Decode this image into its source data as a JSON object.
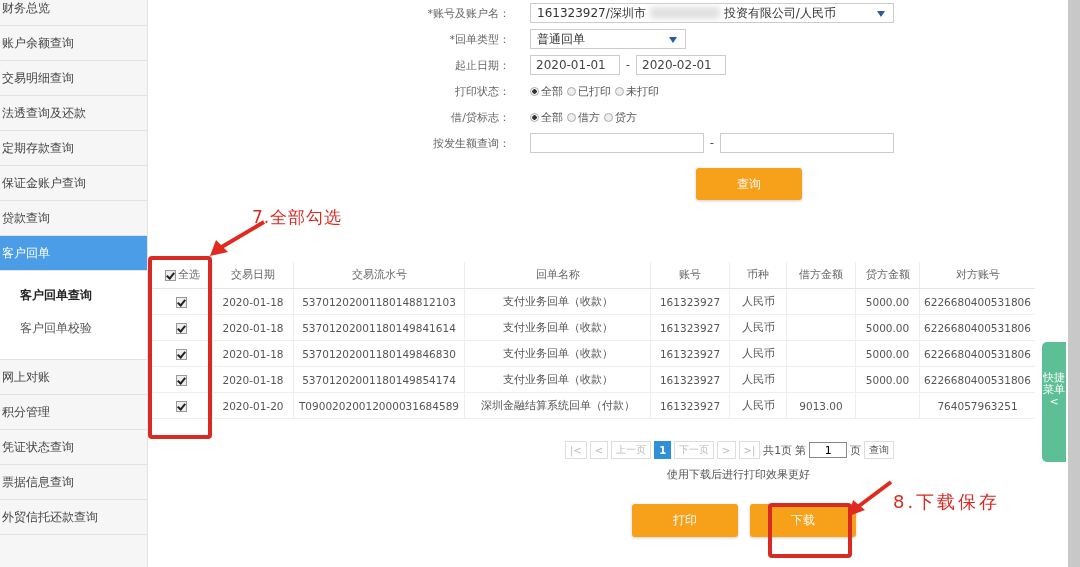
{
  "sidebar": {
    "items": [
      {
        "label": "财务总览",
        "selected": false
      },
      {
        "label": "账户余额查询",
        "selected": false
      },
      {
        "label": "交易明细查询",
        "selected": false
      },
      {
        "label": "法透查询及还款",
        "selected": false
      },
      {
        "label": "定期存款查询",
        "selected": false
      },
      {
        "label": "保证金账户查询",
        "selected": false
      },
      {
        "label": "贷款查询",
        "selected": false
      },
      {
        "label": "客户回单",
        "selected": true,
        "children": [
          {
            "label": "客户回单查询",
            "selected": true
          },
          {
            "label": "客户回单校验",
            "selected": false
          }
        ]
      },
      {
        "label": "网上对账",
        "selected": false
      },
      {
        "label": "积分管理",
        "selected": false
      },
      {
        "label": "凭证状态查询",
        "selected": false
      },
      {
        "label": "票据信息查询",
        "selected": false
      },
      {
        "label": "外贸信托还款查询",
        "selected": false
      }
    ]
  },
  "form": {
    "account": {
      "label": "*账号及账户名：",
      "value_start": "161323927/深圳市",
      "value_end": "投资有限公司/人民币",
      "blurred": true
    },
    "receipt_type": {
      "label": "*回单类型：",
      "value": "普通回单"
    },
    "date_range": {
      "label": "起止日期：",
      "from": "2020-01-01",
      "separator": "-",
      "to": "2020-02-01"
    },
    "print_status": {
      "label": "打印状态：",
      "options": [
        {
          "label": "全部",
          "selected": true
        },
        {
          "label": "已打印",
          "selected": false
        },
        {
          "label": "未打印",
          "selected": false
        }
      ]
    },
    "debit_credit": {
      "label": "借/贷标志：",
      "options": [
        {
          "label": "全部",
          "selected": true
        },
        {
          "label": "借方",
          "selected": false
        },
        {
          "label": "贷方",
          "selected": false
        }
      ]
    },
    "amount_range": {
      "label": "按发生额查询：",
      "separator": "-"
    },
    "query_button": "查询"
  },
  "table": {
    "select_all": {
      "label": "全选",
      "checked": true
    },
    "columns": [
      "交易日期",
      "交易流水号",
      "回单名称",
      "账号",
      "币种",
      "借方金额",
      "贷方金额",
      "对方账号"
    ],
    "rows": [
      {
        "checked": true,
        "cells": [
          "2020-01-18",
          "53701202001180148812103",
          "支付业务回单（收款）",
          "161323927",
          "人民币",
          "",
          "5000.00",
          "6226680400531806"
        ]
      },
      {
        "checked": true,
        "cells": [
          "2020-01-18",
          "53701202001180149841614",
          "支付业务回单（收款）",
          "161323927",
          "人民币",
          "",
          "5000.00",
          "6226680400531806"
        ]
      },
      {
        "checked": true,
        "cells": [
          "2020-01-18",
          "53701202001180149846830",
          "支付业务回单（收款）",
          "161323927",
          "人民币",
          "",
          "5000.00",
          "6226680400531806"
        ]
      },
      {
        "checked": true,
        "cells": [
          "2020-01-18",
          "53701202001180149854174",
          "支付业务回单（收款）",
          "161323927",
          "人民币",
          "",
          "5000.00",
          "6226680400531806"
        ]
      },
      {
        "checked": true,
        "cells": [
          "2020-01-20",
          "T09002020012000031684589",
          "深圳金融结算系统回单（付款）",
          "161323927",
          "人民币",
          "9013.00",
          "",
          "764057963251"
        ]
      }
    ]
  },
  "pagination": {
    "buttons": [
      {
        "label": "|<",
        "disabled": true
      },
      {
        "label": "<",
        "disabled": true
      },
      {
        "label": "上一页",
        "disabled": true
      },
      {
        "label": "1",
        "selected": true
      },
      {
        "label": "下一页",
        "disabled": true
      },
      {
        "label": ">",
        "disabled": true
      },
      {
        "label": ">|",
        "disabled": true
      }
    ],
    "total": "共1页",
    "page_prefix": "第",
    "page_value": "1",
    "page_suffix": "页",
    "go": "查询"
  },
  "note": "使用下载后进行打印效果更好",
  "actions": [
    "打印",
    "下载"
  ],
  "quick_menu": "快捷菜单<",
  "annotations": [
    {
      "text": "7.全部勾选"
    },
    {
      "text": "8.下载保存"
    }
  ]
}
